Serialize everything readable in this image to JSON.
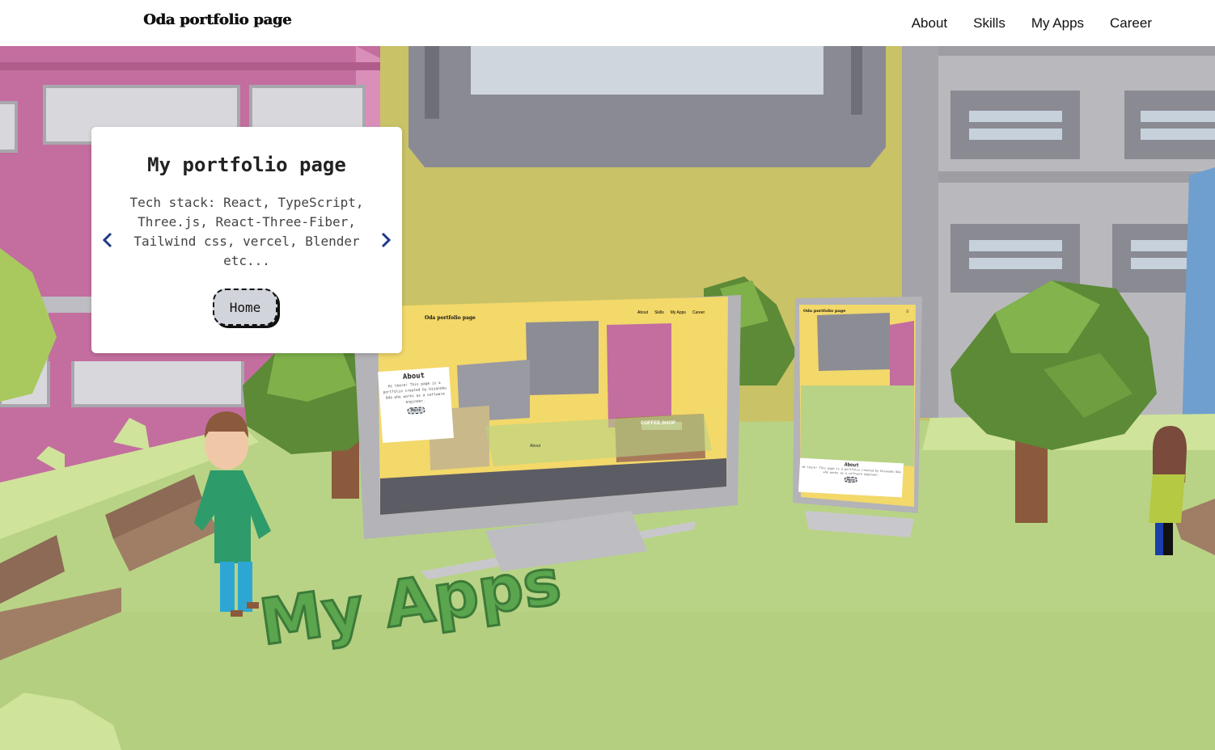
{
  "header": {
    "logo": "Oda portfolio page",
    "nav": [
      "About",
      "Skills",
      "My Apps",
      "Career"
    ]
  },
  "card": {
    "title": "My portfolio page",
    "description": "Tech stack: React, TypeScript, Three.js, React-Three-Fiber, Tailwind css, vercel, Blender etc...",
    "button": "Home"
  },
  "scene": {
    "sign_text": "My Apps",
    "monitor": {
      "logo": "Oda portfolio page",
      "nav": [
        "About",
        "Skills",
        "My Apps",
        "Career"
      ],
      "about_title": "About",
      "about_text": "Hi there! This page is a portfolio created by Hisanobu Oda who works as a software engineer.",
      "button": "More",
      "shop_sign": "COFFEE SHOP",
      "area_label": "About"
    },
    "phone": {
      "logo": "Oda portfolio page",
      "about_title": "About",
      "about_text": "Hi there! This page is a portfolio created by Hisanobu Oda who works as a software engineer.",
      "button": "More"
    }
  },
  "colors": {
    "accent_arrow": "#1e3a8a",
    "button_bg": "#d1d5db",
    "grass": "#b8d385",
    "wall_yellow": "#c9c266",
    "building_pink": "#c36e9f",
    "building_gray": "#b9b9bd"
  }
}
